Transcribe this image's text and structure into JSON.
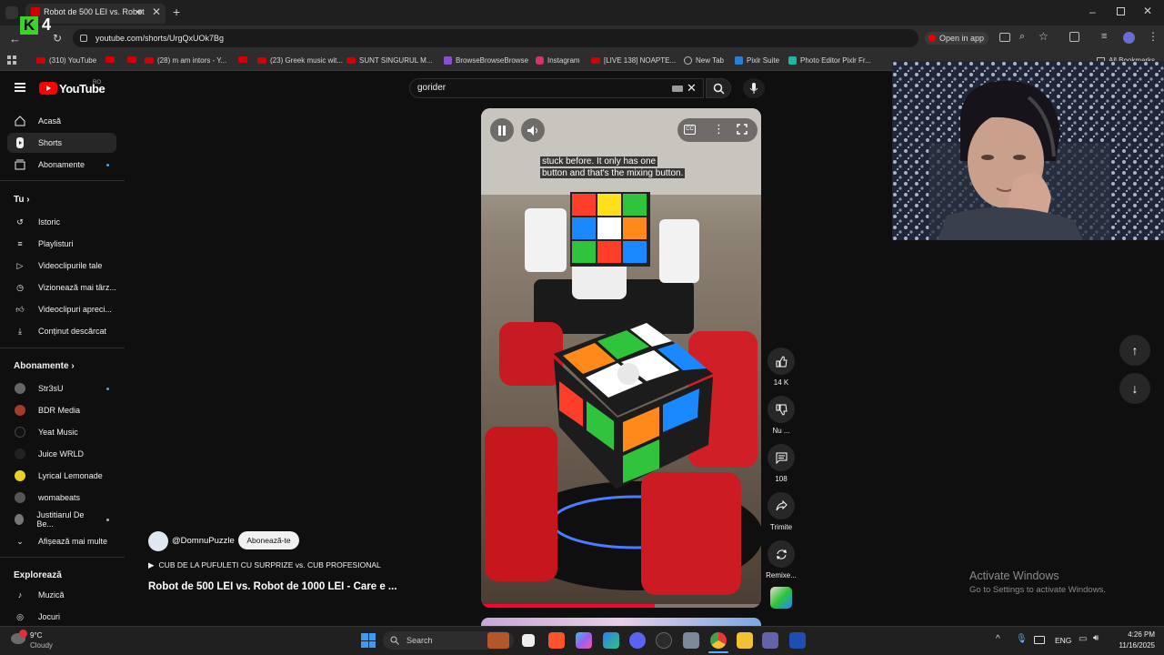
{
  "browser": {
    "tab_title": "Robot de 500 LEI vs. Robot",
    "url": "youtube.com/shorts/UrgQxUOk7Bg",
    "open_in_app": "Open in app",
    "bookmarks": [
      "(310) YouTube",
      "(28) m am intors - Y...",
      "(23) Greek music wit...",
      "SUNT SINGURUL M...",
      "BrowseBrowseBrowse",
      "Instagram",
      "[LIVE 138] NOAPTE...",
      "New Tab",
      "Pixlr Suite",
      "Photo Editor Pixlr Fr...",
      "All Bookmarks"
    ]
  },
  "overlay": {
    "logo_letter": "K",
    "logo_number": "4"
  },
  "youtube": {
    "logo_text": "YouTube",
    "logo_region": "RO",
    "search_value": "gorider",
    "sidebar": {
      "main": [
        "Acasă",
        "Shorts",
        "Abonamente"
      ],
      "tu_header": "Tu",
      "tu_items": [
        "Istoric",
        "Playlisturi",
        "Videoclipurile tale",
        "Vizionează mai târz...",
        "Videoclipuri apreci...",
        "Conținut descărcat"
      ],
      "subs_header": "Abonamente",
      "subs": [
        "Str3sU",
        "BDR Media",
        "Yeat Music",
        "Juice WRLD",
        "Lyrical Lemonade",
        "womabeats",
        "Justitiarul De Be...",
        "Afișează mai multe"
      ],
      "explore_header": "Explorează",
      "explore": [
        "Muzică",
        "Jocuri"
      ]
    },
    "short": {
      "channel": "@DomnuPuzzle",
      "subscribe": "Abonează-te",
      "playlist": "CUB DE LA PUFULETI CU SURPRIZE vs. CUB PROFESIONAL",
      "title": "Robot de 500 LEI vs. Robot de 1000 LEI - Care e ...",
      "caption_line1": "stuck before.  It only has one",
      "caption_line2": "button and that's the mixing button.",
      "progress": 0.62
    },
    "actions": {
      "likes": "14 K",
      "dislike": "Nu ...",
      "comments": "108",
      "share": "Trimite",
      "remix": "Remixe..."
    }
  },
  "windows": {
    "activate_title": "Activate Windows",
    "activate_sub": "Go to Settings to activate Windows.",
    "weather_temp": "9°C",
    "weather_desc": "Cloudy",
    "search": "Search",
    "lang": "ENG",
    "time": "4:26 PM",
    "date": "11/16/2025"
  }
}
